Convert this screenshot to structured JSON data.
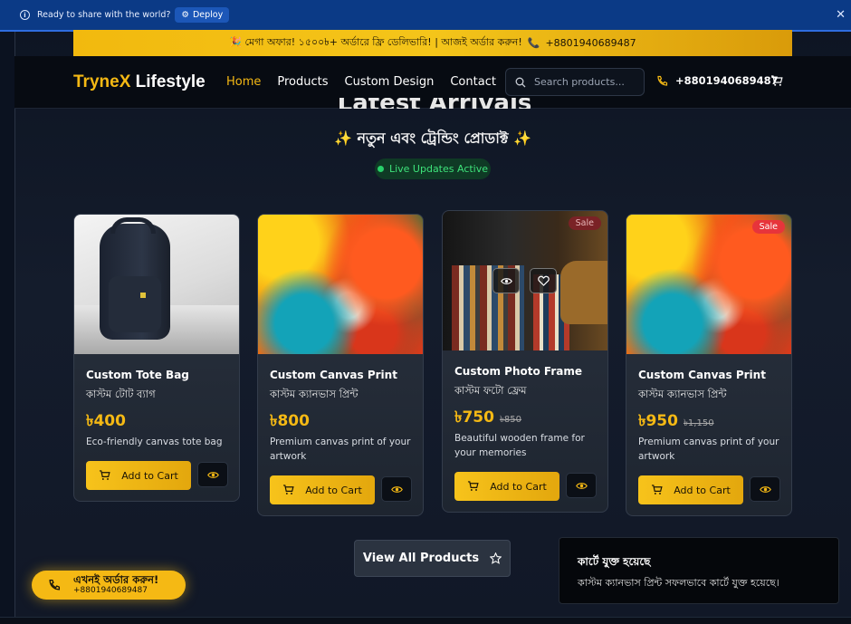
{
  "deploy_bar": {
    "message": "Ready to share with the world?",
    "deploy_label": "Deploy"
  },
  "promo": {
    "text": "🎉 মেগা অফার! ১৫০০৳+ অর্ডারে ফ্রি ডেলিভারি! | আজই অর্ডার করুন!",
    "phone": "+8801940689487"
  },
  "header": {
    "logo_accent": "TryneX",
    "logo_rest": "Lifestyle",
    "nav": [
      "Home",
      "Products",
      "Custom Design",
      "Contact"
    ],
    "search_placeholder": "Search products...",
    "phone": "+8801940689487"
  },
  "section": {
    "title": "Latest Arrivals",
    "subtitle": "✨ নতুন এবং ট্রেন্ডিং প্রোডাক্ট ✨",
    "live_badge": "Live Updates Active"
  },
  "products": [
    {
      "name": "Custom Tote Bag",
      "name_bn": "কাস্টম টোট ব্যাগ",
      "price": "৳400",
      "old_price": "",
      "desc": "Eco-friendly canvas tote bag",
      "cart_label": "Add to Cart",
      "sale": ""
    },
    {
      "name": "Custom Canvas Print",
      "name_bn": "কাস্টম ক্যানভাস প্রিন্ট",
      "price": "৳800",
      "old_price": "",
      "desc": "Premium canvas print of your artwork",
      "cart_label": "Add to Cart",
      "sale": ""
    },
    {
      "name": "Custom Photo Frame",
      "name_bn": "কাস্টম ফটো ফ্রেম",
      "price": "৳750",
      "old_price": "৳850",
      "desc": "Beautiful wooden frame for your memories",
      "cart_label": "Add to Cart",
      "sale": "Sale"
    },
    {
      "name": "Custom Canvas Print",
      "name_bn": "কাস্টম ক্যানভাস প্রিন্ট",
      "price": "৳950",
      "old_price": "৳1,150",
      "desc": "Premium canvas print of your artwork",
      "cart_label": "Add to Cart",
      "sale": "Sale"
    }
  ],
  "view_all_label": "View All Products",
  "order_now": {
    "label": "এখনই অর্ডার করুন!",
    "phone": "+8801940689487"
  },
  "toast": {
    "title": "কার্টে যুক্ত হয়েছে",
    "body": "কাস্টম ক্যানভাস প্রিন্ট সফলভাবে কার্টে যুক্ত হয়েছে।"
  },
  "colors": {
    "accent": "#f5b914",
    "sale": "#e7343b",
    "live": "#28d06a"
  },
  "icons": [
    "info-icon",
    "deploy-icon",
    "close-icon",
    "search-icon",
    "phone-icon",
    "cart-icon",
    "eye-icon",
    "heart-icon",
    "star-icon"
  ]
}
